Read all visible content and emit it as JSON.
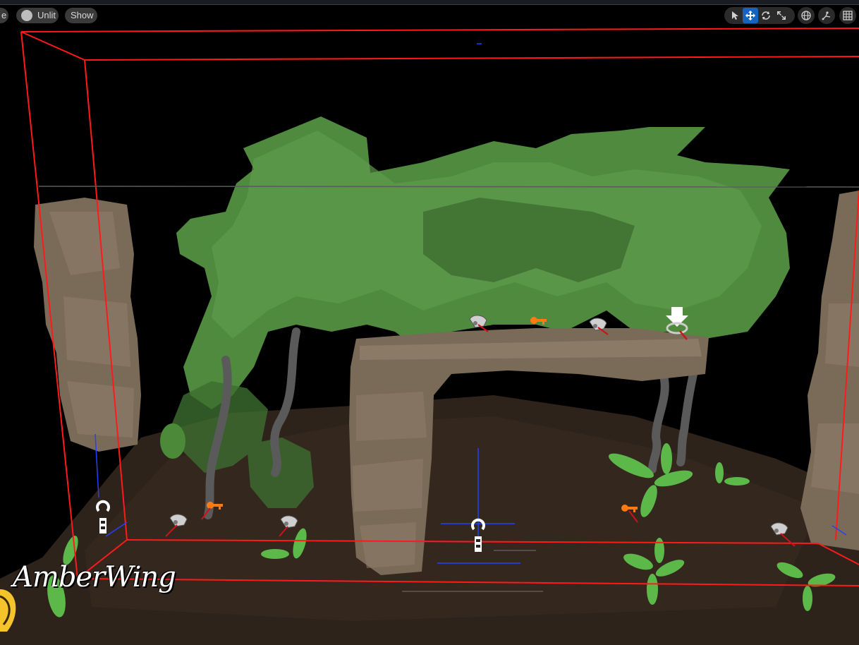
{
  "toolbar": {
    "left_pill_label": "e",
    "lighting_mode_label": "Unlit",
    "show_menu_label": "Show",
    "transform_tools": [
      {
        "icon": "select-arrow-icon",
        "active": false
      },
      {
        "icon": "move-icon",
        "active": true
      },
      {
        "icon": "rotate-icon",
        "active": false
      },
      {
        "icon": "scale-icon",
        "active": false
      }
    ],
    "right_buttons": [
      {
        "icon": "world-globe-icon"
      },
      {
        "icon": "surface-snapping-icon"
      },
      {
        "icon": "grid-snap-icon"
      }
    ]
  },
  "watermark": {
    "brand_text": "AmberWing"
  },
  "colors": {
    "bounds_red": "#ff1a1a",
    "axis_blue": "#2340ff",
    "foliage_green": "#4f8a3e",
    "rock_brown": "#7a6a58",
    "ground": "#2e231b",
    "accent_blue": "#1564c0"
  }
}
